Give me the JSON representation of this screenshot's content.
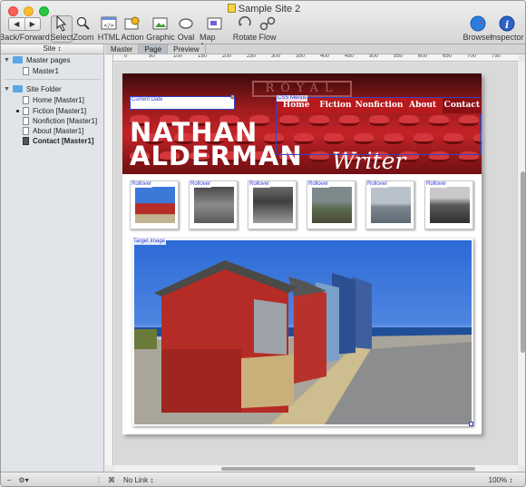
{
  "window": {
    "title": "Sample Site 2"
  },
  "toolbar": {
    "items": [
      {
        "label": "Back/Forward",
        "icon": "back-forward-icon"
      },
      {
        "label": "Select",
        "icon": "select-arrow-icon"
      },
      {
        "label": "Zoom",
        "icon": "zoom-icon"
      },
      {
        "label": "HTML",
        "icon": "html-icon"
      },
      {
        "label": "Action",
        "icon": "action-icon"
      },
      {
        "label": "Graphic",
        "icon": "graphic-icon"
      },
      {
        "label": "Oval",
        "icon": "oval-icon"
      },
      {
        "label": "Map Area",
        "icon": "map-area-icon"
      },
      {
        "label": "Rotate",
        "icon": "rotate-icon"
      },
      {
        "label": "Flow",
        "icon": "flow-icon"
      },
      {
        "label": "Browser",
        "icon": "browser-icon"
      },
      {
        "label": "Inspector",
        "icon": "inspector-icon"
      }
    ]
  },
  "sidebar": {
    "header": "Site ↕",
    "master_group": "Master pages",
    "master_items": [
      "Master1"
    ],
    "site_group": "Site Folder",
    "site_items": [
      "Home [Master1]",
      "Fiction [Master1]",
      "Nonfiction [Master1]",
      "About [Master1]",
      "Contact [Master1]"
    ]
  },
  "tabs": [
    "Master",
    "Page",
    "Preview"
  ],
  "ruler_labels": [
    "0",
    "50",
    "100",
    "150",
    "200",
    "250",
    "300",
    "350",
    "400",
    "450",
    "500",
    "550",
    "600",
    "650",
    "700",
    "750"
  ],
  "page": {
    "header_sign": "ROYAL",
    "current_date_label": "Current Date",
    "css_menus_label": "CSS Menus",
    "nav": [
      "Home",
      "Fiction",
      "Nonfiction",
      "About",
      "Contact"
    ],
    "name_line1": "NATHAN",
    "name_line2": "ALDERMAN",
    "name_script": "Writer",
    "rollover_label": "Rollover",
    "target_label": "Target Image"
  },
  "statusbar": {
    "link": "No Link ↕",
    "zoom": "100% ↕"
  },
  "colors": {
    "header_red": "#b8191d",
    "selection_blue": "#3342c8"
  }
}
